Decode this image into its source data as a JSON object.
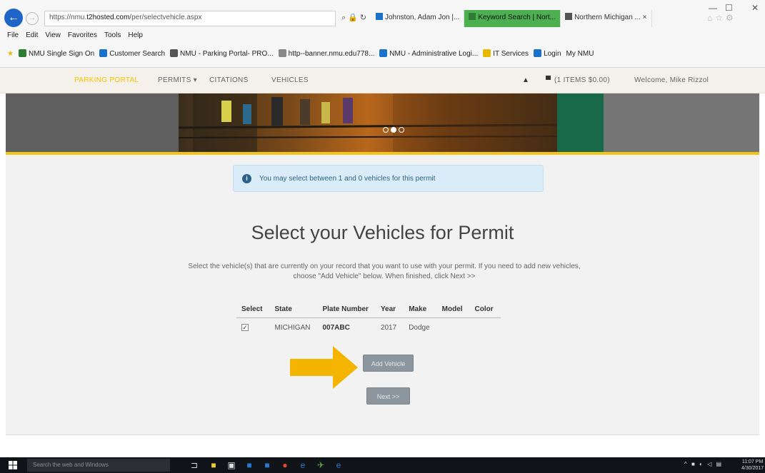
{
  "browser": {
    "address": {
      "scheme": "https://",
      "host_prefix": "nmu.",
      "host": "t2hosted.com",
      "path": "/per/selectvehicle.aspx"
    },
    "tabs": [
      {
        "label": "Johnston, Adam Jon |...",
        "active": false,
        "color": "#1a73c9"
      },
      {
        "label": "Keyword Search | Nort...",
        "active": true,
        "color": "#2e7d32"
      },
      {
        "label": "Northern Michigan ... ×",
        "active": false,
        "color": "#555555"
      }
    ],
    "window_controls": [
      "—",
      "☐",
      "✕"
    ],
    "menu": [
      "File",
      "Edit",
      "View",
      "Favorites",
      "Tools",
      "Help"
    ],
    "favorites": [
      {
        "label": "NMU Single Sign On",
        "color": "#2e7d32"
      },
      {
        "label": "Customer Search",
        "color": "#1a73c9"
      },
      {
        "label": "NMU - Parking Portal- PRO...",
        "color": "#555555"
      },
      {
        "label": "http--banner.nmu.edu778...",
        "color": "#888888"
      },
      {
        "label": "NMU - Administrative Logi...",
        "color": "#1a73c9"
      },
      {
        "label": "IT Services",
        "color": "#e6b800"
      },
      {
        "label": "Login",
        "color": "#1a73c9"
      },
      {
        "label": "My NMU",
        "color": ""
      }
    ]
  },
  "site_nav": {
    "brand": "PARKING PORTAL",
    "permits": "PERMITS ▾",
    "citations": "CITATIONS",
    "vehicles": "VEHICLES",
    "cart": "(1 ITEMS $0.00)",
    "welcome": "Welcome, Mike Rizzol"
  },
  "page": {
    "alert": "You may select between 1 and 0 vehicles for this permit",
    "title": "Select your Vehicles for Permit",
    "description": "Select the vehicle(s) that are currently on your record that you want to use with your permit. If you need to add new vehicles, choose \"Add Vehicle\" below. When finished, click Next >>",
    "table": {
      "headers": [
        "Select",
        "State",
        "Plate Number",
        "Year",
        "Make",
        "Model",
        "Color"
      ],
      "rows": [
        {
          "selected": true,
          "state": "MICHIGAN",
          "plate": "007ABC",
          "year": "2017",
          "make": "Dodge",
          "model": "",
          "color": ""
        }
      ]
    },
    "add_vehicle": "Add Vehicle",
    "next": "Next >>"
  },
  "taskbar": {
    "search_placeholder": "Search the web and Windows",
    "clock_time": "11:07 PM",
    "clock_date": "4/30/2017"
  },
  "colors": {
    "accent_gold": "#f0c419",
    "alert_bg": "#d9ecf7",
    "button_gray": "#8c969f",
    "arrow": "#f5b400"
  }
}
